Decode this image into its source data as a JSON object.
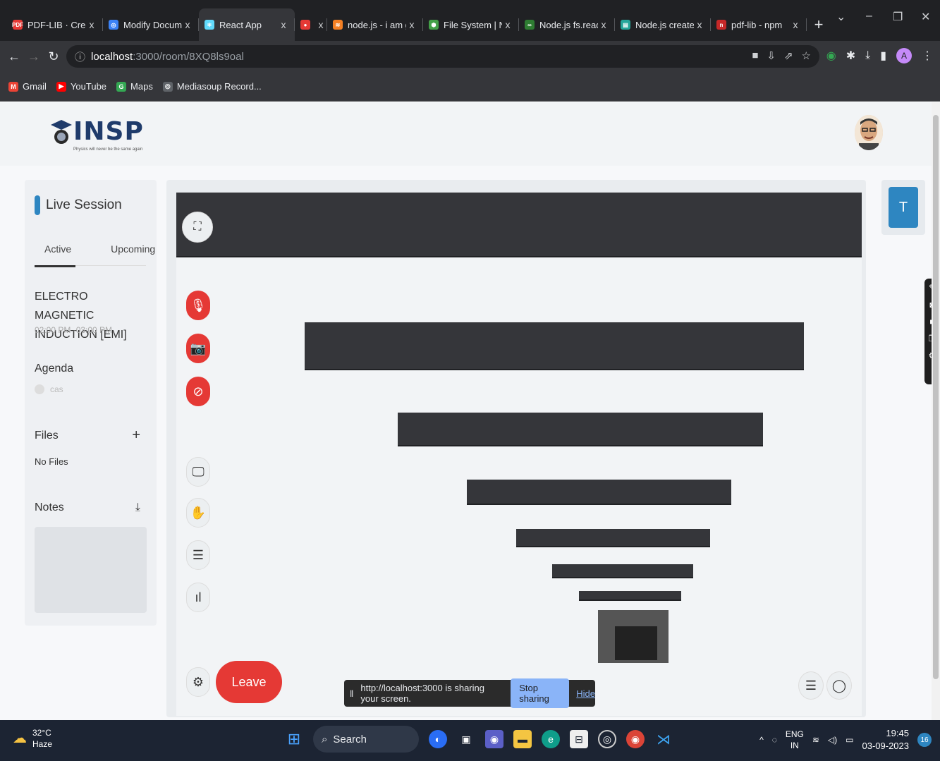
{
  "browser": {
    "tabs": [
      {
        "title": "PDF-LIB · Create a",
        "favicon_color": "#e53935",
        "favicon_text": "PDF"
      },
      {
        "title": "Modify Documen",
        "favicon_color": "#3b82f6",
        "favicon_text": "◎"
      },
      {
        "title": "React App",
        "favicon_color": "#61dafb",
        "favicon_text": "⚛",
        "active": true
      },
      {
        "title": "",
        "favicon_color": "#e53935",
        "favicon_text": "●"
      },
      {
        "title": "node.js - i am get",
        "favicon_color": "#f48024",
        "favicon_text": "≋"
      },
      {
        "title": "File System | Nod",
        "favicon_color": "#43a047",
        "favicon_text": "⬢"
      },
      {
        "title": "Node.js fs.readFil",
        "favicon_color": "#2e7d32",
        "favicon_text": "∞"
      },
      {
        "title": "Node.js createWr",
        "favicon_color": "#26a69a",
        "favicon_text": "▤"
      },
      {
        "title": "pdf-lib - npm",
        "favicon_color": "#c62828",
        "favicon_text": "n"
      }
    ],
    "tab_close": "x",
    "new_tab": "+",
    "url_host": "localhost",
    "url_path": ":3000/room/8XQ8ls9oal",
    "profile_initial": "A",
    "bookmarks": [
      {
        "label": "Gmail",
        "color": "#ea4335",
        "icon": "M"
      },
      {
        "label": "YouTube",
        "color": "#ff0000",
        "icon": "▶"
      },
      {
        "label": "Maps",
        "color": "#34a853",
        "icon": "G"
      },
      {
        "label": "Mediasoup Record...",
        "color": "#5f6368",
        "icon": "◎"
      }
    ]
  },
  "app": {
    "logo_text": "INSP",
    "logo_tagline": "Physics will never be the same again",
    "sidebar": {
      "title": "Live Session",
      "tabs": [
        "Active",
        "Upcoming"
      ],
      "session_title": "ELECTRO MAGNETIC INDUCTION [EMI]",
      "session_time": "02:00 PM -03:00 PM",
      "agenda_label": "Agenda",
      "agenda_item": "cas",
      "files_label": "Files",
      "files_add": "+",
      "no_files": "No Files",
      "notes_label": "Notes",
      "notes_download": "⤓"
    },
    "participant_initial": "T",
    "leave_label": "Leave",
    "share_bar": {
      "message": "http://localhost:3000 is sharing your screen.",
      "stop_label": "Stop sharing",
      "hide_label": "Hide"
    }
  },
  "taskbar": {
    "temperature": "32°C",
    "condition": "Haze",
    "search_label": "Search",
    "lang": "ENG",
    "region": "IN",
    "time": "19:45",
    "date": "03-09-2023",
    "notif_count": "16"
  }
}
